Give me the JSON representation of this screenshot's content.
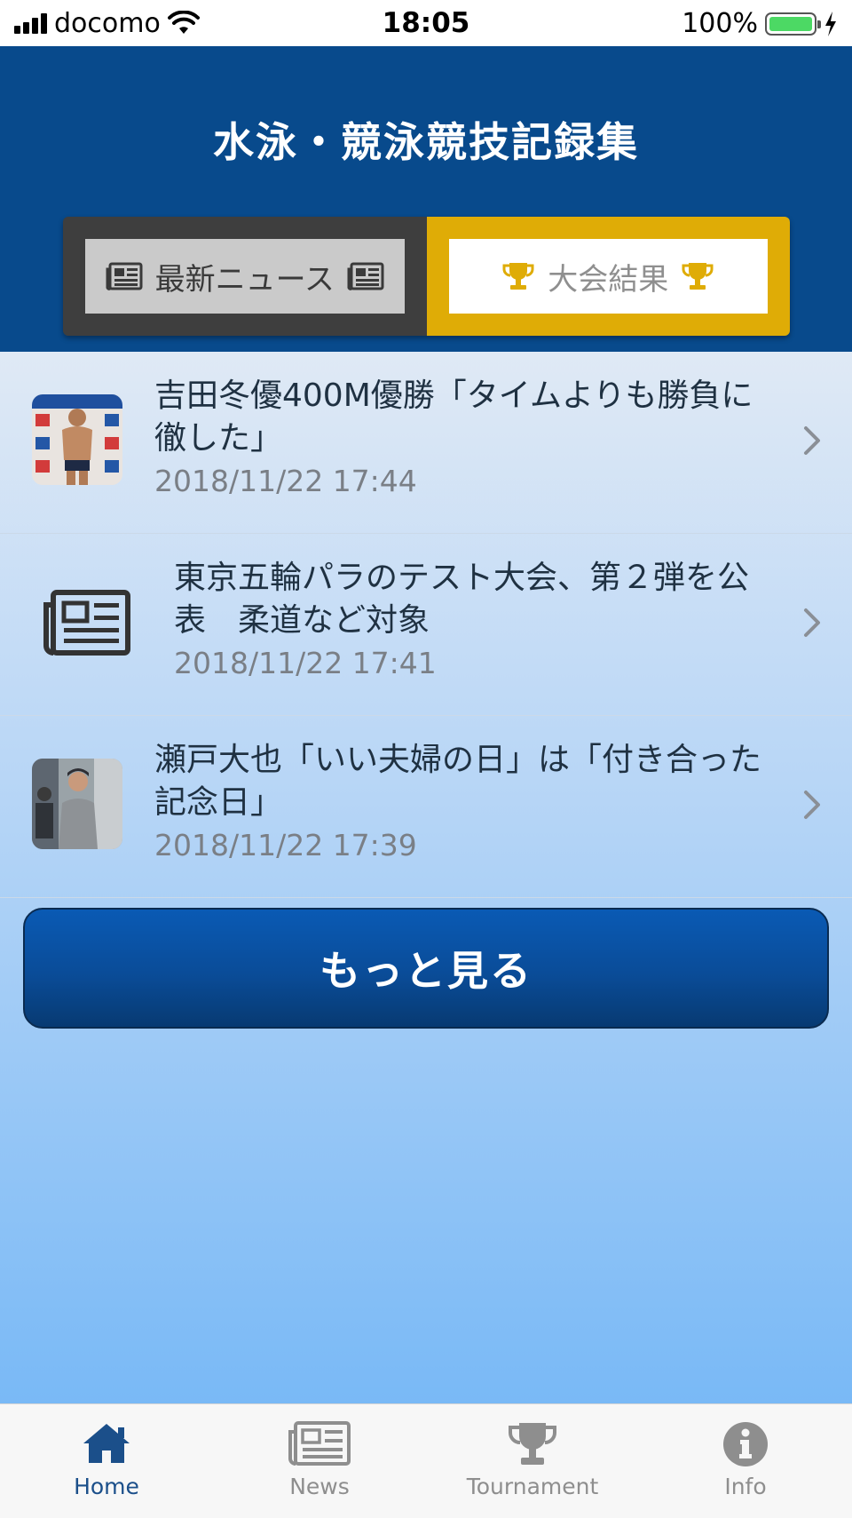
{
  "status_bar": {
    "carrier": "docomo",
    "time": "18:05",
    "battery": "100%",
    "battery_level": 1.0
  },
  "header": {
    "title": "水泳・競泳競技記録集",
    "segments": [
      {
        "label": "最新ニュース",
        "icon": "newspaper-icon"
      },
      {
        "label": "大会結果",
        "icon": "trophy-icon"
      }
    ]
  },
  "news": [
    {
      "title": "吉田冬優400M優勝「タイムよりも勝負に徹した」",
      "time": "2018/11/22 17:44",
      "thumbnail": "swimmer-photo"
    },
    {
      "title": "東京五輪パラのテスト大会、第２弾を公表　柔道など対象",
      "time": "2018/11/22 17:41",
      "thumbnail": "newspaper-icon"
    },
    {
      "title": "瀬戸大也「いい夫婦の日」は「付き合った記念日」",
      "time": "2018/11/22 17:39",
      "thumbnail": "athlete-photo"
    }
  ],
  "more_button": "もっと見る",
  "tabs": [
    {
      "label": "Home",
      "icon": "home-icon",
      "active": true
    },
    {
      "label": "News",
      "icon": "newspaper-icon",
      "active": false
    },
    {
      "label": "Tournament",
      "icon": "trophy-icon",
      "active": false
    },
    {
      "label": "Info",
      "icon": "info-icon",
      "active": false
    }
  ],
  "colors": {
    "header": "#084a8c",
    "accent_gold": "#dfac06",
    "tab_active": "#1b4f8a",
    "tab_inactive": "#8e8e8e"
  }
}
